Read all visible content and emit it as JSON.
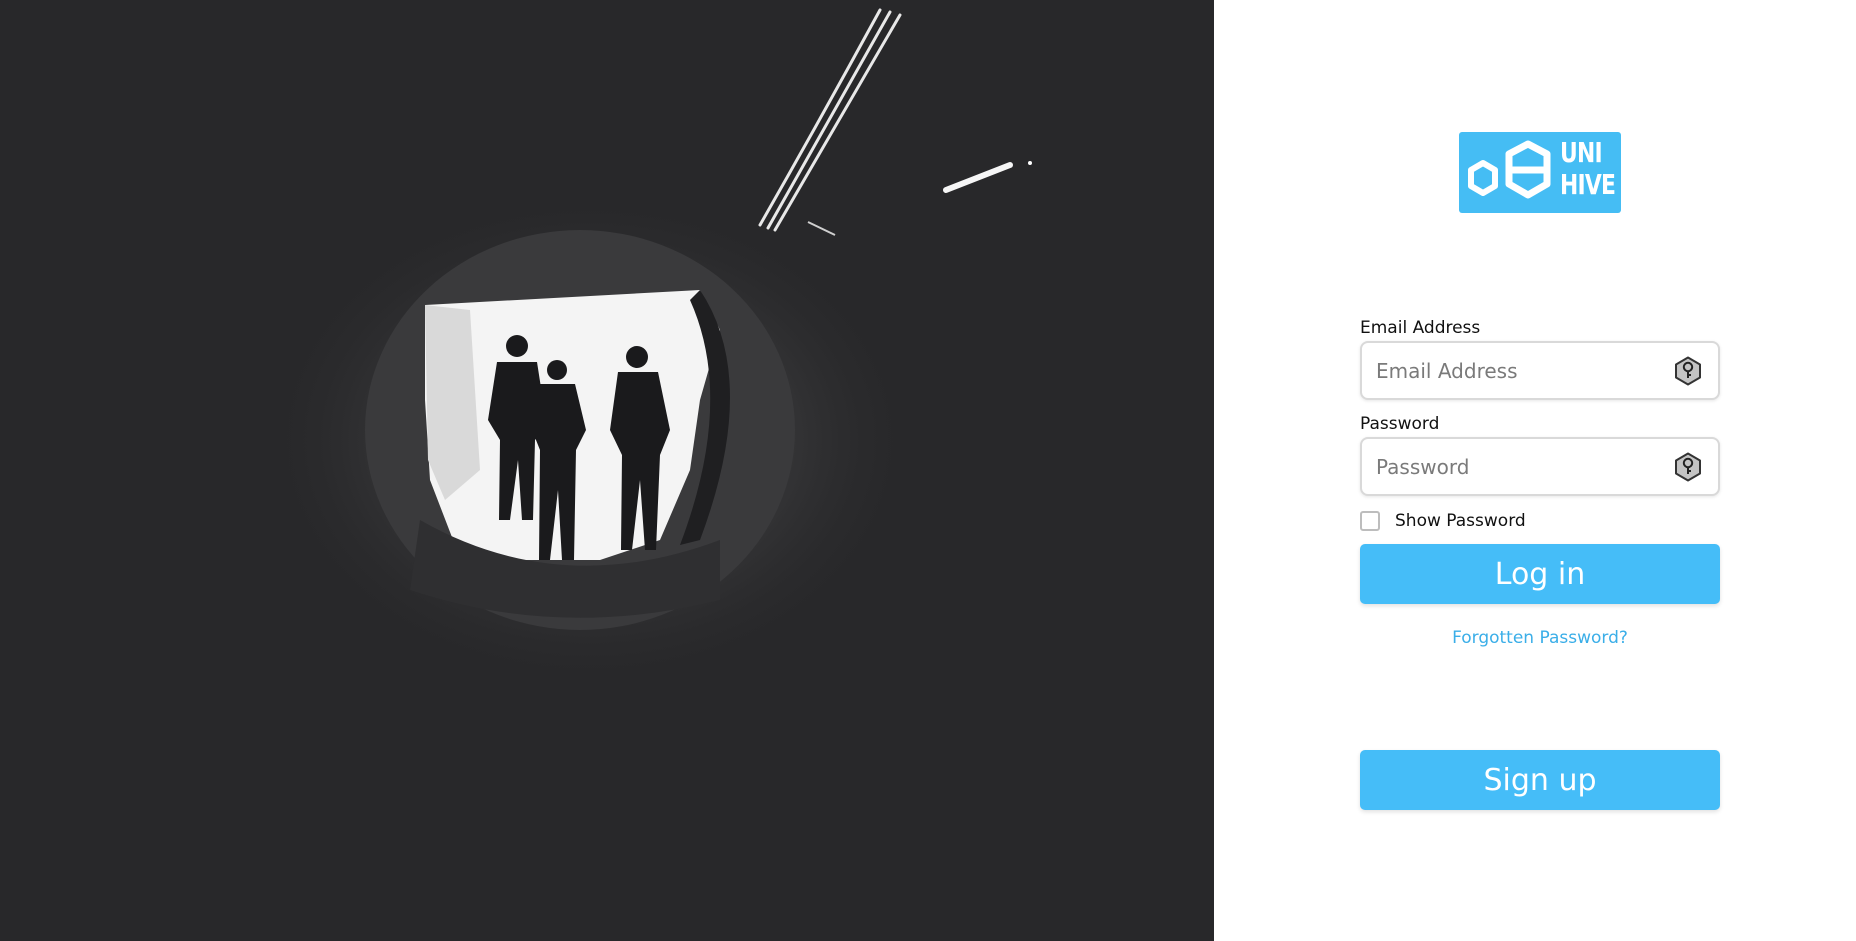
{
  "hero": {
    "image": "black-and-white photo of three silhouetted people walking out of a dark tunnel into bright light"
  },
  "logo": {
    "line1": "UNI",
    "line2": "HIVE",
    "brand_color": "#45bdf4"
  },
  "form": {
    "email_label": "Email Address",
    "email_placeholder": "Email Address",
    "email_value": "",
    "email_icon": "hex-key-icon",
    "password_label": "Password",
    "password_placeholder": "Password",
    "password_value": "",
    "password_icon": "hex-key-icon",
    "show_password_label": "Show Password",
    "show_password_checked": false,
    "login_button": "Log in",
    "forgot_link": "Forgotten Password?",
    "signup_button": "Sign up"
  },
  "colors": {
    "accent": "#45bdf8",
    "link": "#3aaee8",
    "hero_background": "#28282a"
  }
}
